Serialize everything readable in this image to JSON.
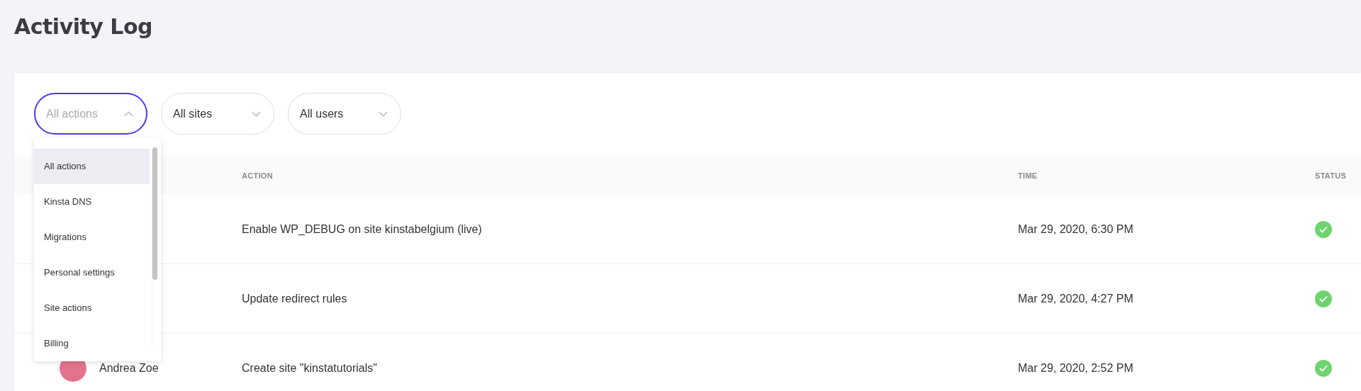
{
  "title": "Activity Log",
  "filters": [
    {
      "label": "All actions",
      "open": true
    },
    {
      "label": "All sites",
      "open": false
    },
    {
      "label": "All users",
      "open": false
    }
  ],
  "dropdown": {
    "items": [
      {
        "label": "All actions",
        "selected": true
      },
      {
        "label": "Kinsta DNS",
        "selected": false
      },
      {
        "label": "Migrations",
        "selected": false
      },
      {
        "label": "Personal settings",
        "selected": false
      },
      {
        "label": "Site actions",
        "selected": false
      },
      {
        "label": "Billing",
        "selected": false
      }
    ]
  },
  "table": {
    "columns": [
      "ACTION",
      "TIME",
      "STATUS"
    ],
    "rows": [
      {
        "action": "Enable WP_DEBUG on site kinstabelgium (live)",
        "time": "Mar 29, 2020, 6:30 PM",
        "success": true
      },
      {
        "action": "Update redirect rules",
        "time": "Mar 29, 2020, 4:27 PM",
        "success": true
      },
      {
        "user": "Andrea Zoe",
        "action": "Create site \"kinstatutorials\"",
        "time": "Mar 29, 2020, 2:52 PM",
        "success": true
      }
    ]
  }
}
